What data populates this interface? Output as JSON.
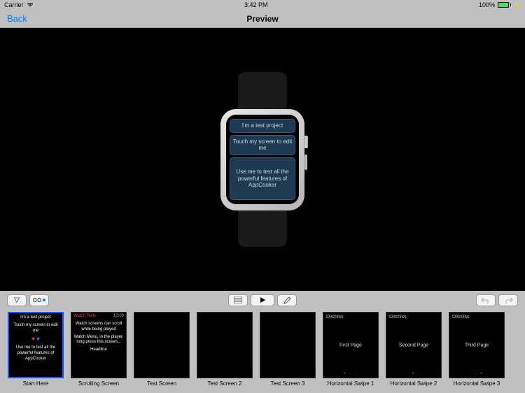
{
  "status": {
    "carrier": "Carrier",
    "time": "3:42 PM",
    "battery": "100%"
  },
  "nav": {
    "back": "Back",
    "title": "Preview"
  },
  "watch": {
    "cell1": "I'm a test project",
    "cell2": "Touch my screen to edit me",
    "cell3": "Use me to test all the powerful features of AppCooker"
  },
  "toolbar": {
    "dropdown": "▽",
    "link": "⚭",
    "list": "list",
    "play": "▶",
    "edit": "✎",
    "undo": "↶",
    "redo": "↷"
  },
  "thumbs": [
    {
      "label": "Start Here",
      "selected": true,
      "type": "start",
      "lines": [
        "I'm a test project",
        "Touch my screen to edit me",
        "★",
        "Use me to test all the powerful features of AppCooker"
      ]
    },
    {
      "label": "Scrolling Screen",
      "type": "scroll",
      "header_left": "Watch Tests",
      "header_right": "10:09",
      "body": [
        "Watch screens can scroll while being played",
        "",
        "Watch Menu, in the player, long press this screen...",
        "Headline"
      ]
    },
    {
      "label": "Test Screen",
      "type": "blank"
    },
    {
      "label": "Test Screen 2",
      "type": "blank"
    },
    {
      "label": "Test Screen 3",
      "type": "blank"
    },
    {
      "label": "Horizontal Swipe 1",
      "type": "swipe",
      "dismiss": "Dismiss",
      "page": "First Page",
      "dots": "• · ·"
    },
    {
      "label": "Horizontal Swipe 2",
      "type": "swipe",
      "dismiss": "Dismiss",
      "page": "Second Page",
      "dots": "· • ·"
    },
    {
      "label": "Horizontal Swipe 3",
      "type": "swipe",
      "dismiss": "Dismiss",
      "page": "Third Page",
      "dots": "· · •"
    }
  ]
}
